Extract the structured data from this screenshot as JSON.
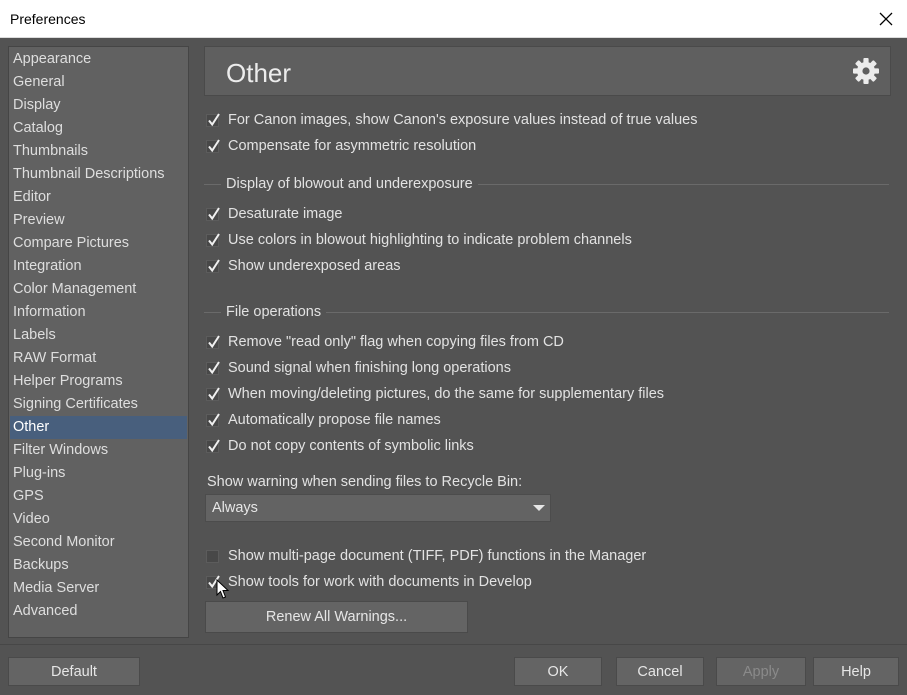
{
  "window": {
    "title": "Preferences"
  },
  "sidebar": {
    "items": [
      {
        "label": "Appearance"
      },
      {
        "label": "General"
      },
      {
        "label": "Display"
      },
      {
        "label": "Catalog"
      },
      {
        "label": "Thumbnails"
      },
      {
        "label": "Thumbnail Descriptions"
      },
      {
        "label": "Editor"
      },
      {
        "label": "Preview"
      },
      {
        "label": "Compare Pictures"
      },
      {
        "label": "Integration"
      },
      {
        "label": "Color Management"
      },
      {
        "label": "Information"
      },
      {
        "label": "Labels"
      },
      {
        "label": "RAW Format"
      },
      {
        "label": "Helper Programs"
      },
      {
        "label": "Signing Certificates"
      },
      {
        "label": "Other",
        "selected": true
      },
      {
        "label": "Filter Windows"
      },
      {
        "label": "Plug-ins"
      },
      {
        "label": "GPS"
      },
      {
        "label": "Video"
      },
      {
        "label": "Second Monitor"
      },
      {
        "label": "Backups"
      },
      {
        "label": "Media Server"
      },
      {
        "label": "Advanced"
      }
    ]
  },
  "page": {
    "title": "Other",
    "icon": "gear-icon",
    "top_options": [
      {
        "label": "For Canon images, show Canon's exposure values instead of true values",
        "checked": true
      },
      {
        "label": "Compensate for asymmetric resolution",
        "checked": true
      }
    ],
    "blowout_group": {
      "title": "Display of blowout and underexposure",
      "options": [
        {
          "label": "Desaturate image",
          "checked": true
        },
        {
          "label": "Use colors in blowout highlighting to indicate problem channels",
          "checked": true
        },
        {
          "label": "Show underexposed areas",
          "checked": true
        }
      ]
    },
    "fileops_group": {
      "title": "File operations",
      "options": [
        {
          "label": "Remove \"read only\" flag when copying files from CD",
          "checked": true
        },
        {
          "label": "Sound signal when finishing long operations",
          "checked": true
        },
        {
          "label": "When moving/deleting pictures, do the same for supplementary files",
          "checked": true
        },
        {
          "label": "Automatically propose file names",
          "checked": true
        },
        {
          "label": "Do not copy contents of symbolic links",
          "checked": true
        }
      ]
    },
    "recycle_warning": {
      "label": "Show warning when sending files to Recycle Bin:",
      "value": "Always"
    },
    "bottom_options": [
      {
        "label": "Show multi-page document (TIFF, PDF) functions in the Manager",
        "checked": false
      },
      {
        "label": "Show tools for work with documents in Develop",
        "checked": true
      }
    ],
    "renew_button": "Renew All Warnings..."
  },
  "footer": {
    "default": "Default",
    "ok": "OK",
    "cancel": "Cancel",
    "apply": "Apply",
    "help": "Help"
  },
  "colors": {
    "background": "#535353",
    "selection": "#485f7d",
    "text": "#e2e2e2"
  }
}
